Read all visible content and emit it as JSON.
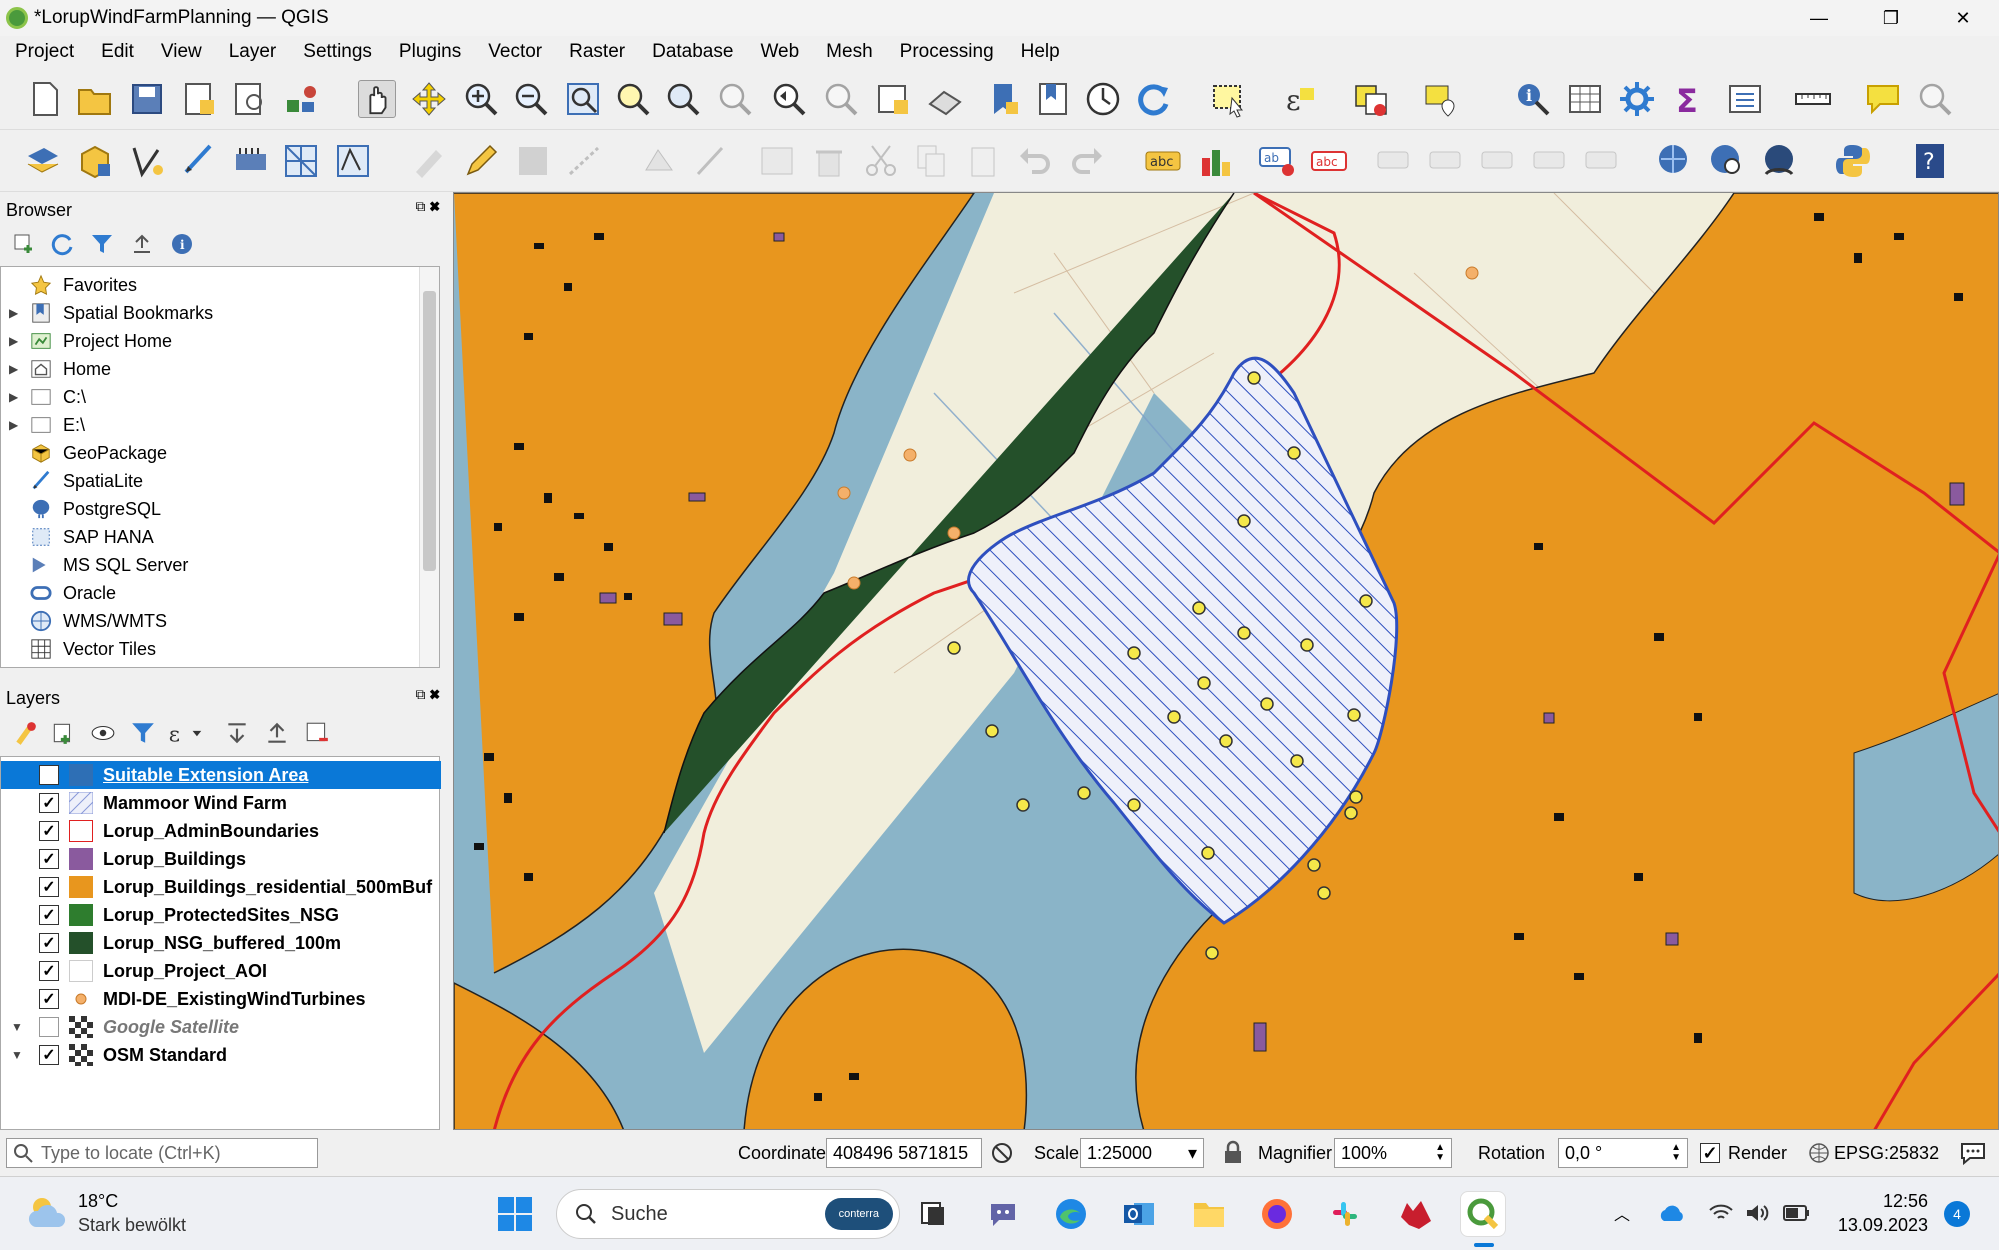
{
  "window": {
    "title": "*LorupWindFarmPlanning — QGIS",
    "minimize": "—",
    "restore": "❐",
    "close": "✕"
  },
  "menu": [
    "Project",
    "Edit",
    "View",
    "Layer",
    "Settings",
    "Plugins",
    "Vector",
    "Raster",
    "Database",
    "Web",
    "Mesh",
    "Processing",
    "Help"
  ],
  "browser": {
    "title": "Browser",
    "items": [
      {
        "label": "Favorites",
        "expandable": false,
        "icon": "star-icon"
      },
      {
        "label": "Spatial Bookmarks",
        "expandable": true,
        "icon": "bookmark-icon"
      },
      {
        "label": "Project Home",
        "expandable": true,
        "icon": "project-home-icon"
      },
      {
        "label": "Home",
        "expandable": true,
        "icon": "home-icon"
      },
      {
        "label": "C:\\",
        "expandable": true,
        "icon": "drive-icon"
      },
      {
        "label": "E:\\",
        "expandable": true,
        "icon": "drive-icon"
      },
      {
        "label": "GeoPackage",
        "expandable": false,
        "icon": "geopackage-icon"
      },
      {
        "label": "SpatiaLite",
        "expandable": false,
        "icon": "spatialite-icon"
      },
      {
        "label": "PostgreSQL",
        "expandable": false,
        "icon": "postgresql-icon"
      },
      {
        "label": "SAP HANA",
        "expandable": false,
        "icon": "saphana-icon"
      },
      {
        "label": "MS SQL Server",
        "expandable": false,
        "icon": "mssql-icon"
      },
      {
        "label": "Oracle",
        "expandable": false,
        "icon": "oracle-icon"
      },
      {
        "label": "WMS/WMTS",
        "expandable": false,
        "icon": "wms-icon"
      },
      {
        "label": "Vector Tiles",
        "expandable": false,
        "icon": "vector-tiles-icon"
      }
    ]
  },
  "layers": {
    "title": "Layers",
    "items": [
      {
        "label": "Suitable Extension Area",
        "checked": true,
        "color": "#2e6fb5",
        "selected": true,
        "italic": false
      },
      {
        "label": "Mammoor Wind Farm",
        "checked": true,
        "color": "hatch",
        "selected": false,
        "italic": false
      },
      {
        "label": "Lorup_AdminBoundaries",
        "checked": true,
        "color": "#e02020",
        "selected": false,
        "italic": false
      },
      {
        "label": "Lorup_Buildings",
        "checked": true,
        "color": "#8a5a9e",
        "selected": false,
        "italic": false
      },
      {
        "label": "Lorup_Buildings_residential_500mBuf",
        "checked": true,
        "color": "#e8961e",
        "selected": false,
        "italic": false
      },
      {
        "label": "Lorup_ProtectedSites_NSG",
        "checked": true,
        "color": "#2e7d2e",
        "selected": false,
        "italic": false
      },
      {
        "label": "Lorup_NSG_buffered_100m",
        "checked": true,
        "color": "#24502a",
        "selected": false,
        "italic": false
      },
      {
        "label": "Lorup_Project_AOI",
        "checked": true,
        "color": "#ffffff",
        "selected": false,
        "italic": false
      },
      {
        "label": "MDI-DE_ExistingWindTurbines",
        "checked": true,
        "color": "point",
        "selected": false,
        "italic": false
      },
      {
        "label": "Google Satellite",
        "checked": false,
        "color": "raster",
        "selected": false,
        "italic": true
      },
      {
        "label": "OSM Standard",
        "checked": true,
        "color": "raster",
        "selected": false,
        "italic": false
      }
    ]
  },
  "status": {
    "locate_placeholder": "Type to locate (Ctrl+K)",
    "coordinate_label": "Coordinate",
    "coordinate_value": "408496  5871815",
    "scale_label": "Scale",
    "scale_value": "1:25000",
    "magnifier_label": "Magnifier",
    "magnifier_value": "100%",
    "rotation_label": "Rotation",
    "rotation_value": "0,0 °",
    "render_label": "Render",
    "render_checked": true,
    "crs": "EPSG:25832"
  },
  "taskbar": {
    "weather_temp": "18°C",
    "weather_desc": "Stark bewölkt",
    "search_label": "Suche",
    "search_badge": "conterra",
    "time": "12:56",
    "date": "13.09.2023",
    "notifications": "4"
  },
  "colors": {
    "buffer_orange": "#e8961e",
    "water_blue": "#8ab4c8",
    "nsg_dark": "#24502a",
    "admin_red": "#e02020",
    "land_cream": "#f1eedc",
    "windfarm_blue": "#2e4fbf",
    "turbine_yellow": "#f5e84a"
  }
}
